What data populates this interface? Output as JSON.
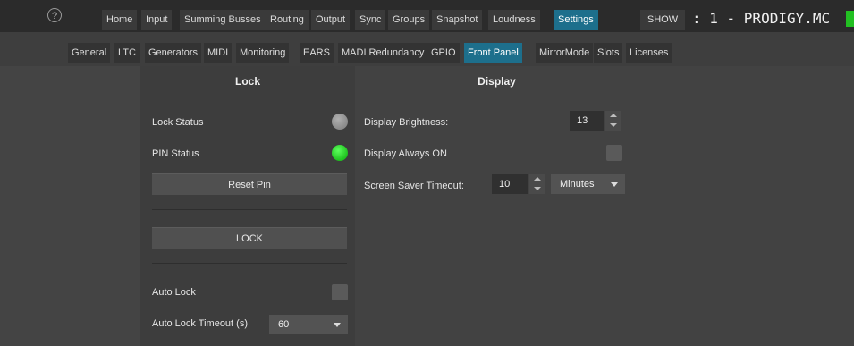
{
  "topnav": {
    "help_icon": "?",
    "items": [
      {
        "label": "Home"
      },
      {
        "label": "Input"
      },
      {
        "label": "Summing Busses"
      },
      {
        "label": "Routing"
      },
      {
        "label": "Output"
      },
      {
        "label": "Sync"
      },
      {
        "label": "Groups"
      },
      {
        "label": "Snapshot"
      },
      {
        "label": "Loudness"
      },
      {
        "label": "Settings",
        "active": true
      }
    ],
    "show_label": "SHOW",
    "show_title": ": 1 - PRODIGY.MC",
    "status_color": "#22c022"
  },
  "subtabs": {
    "items": [
      {
        "label": "General"
      },
      {
        "label": "LTC"
      },
      {
        "label": "Generators"
      },
      {
        "label": "MIDI"
      },
      {
        "label": "Monitoring"
      },
      {
        "label": "EARS"
      },
      {
        "label": "MADI Redundancy"
      },
      {
        "label": "GPIO"
      },
      {
        "label": "Front Panel",
        "active": true
      },
      {
        "label": "MirrorMode"
      },
      {
        "label": "Slots"
      },
      {
        "label": "Licenses"
      }
    ]
  },
  "lock": {
    "heading": "Lock",
    "lock_status_label": "Lock Status",
    "lock_status_color": "#8a8a8a",
    "pin_status_label": "PIN Status",
    "pin_status_color": "#1fc21f",
    "reset_pin_label": "Reset Pin",
    "lock_button_label": "LOCK",
    "auto_lock_label": "Auto Lock",
    "auto_lock_timeout_label": "Auto Lock Timeout (s)",
    "auto_lock_timeout_value": "60"
  },
  "display": {
    "heading": "Display",
    "brightness_label": "Display Brightness:",
    "brightness_value": "13",
    "always_on_label": "Display Always ON",
    "screensaver_label": "Screen Saver Timeout:",
    "screensaver_value": "10",
    "screensaver_unit": "Minutes"
  },
  "accent_color": "#1d6f8c"
}
